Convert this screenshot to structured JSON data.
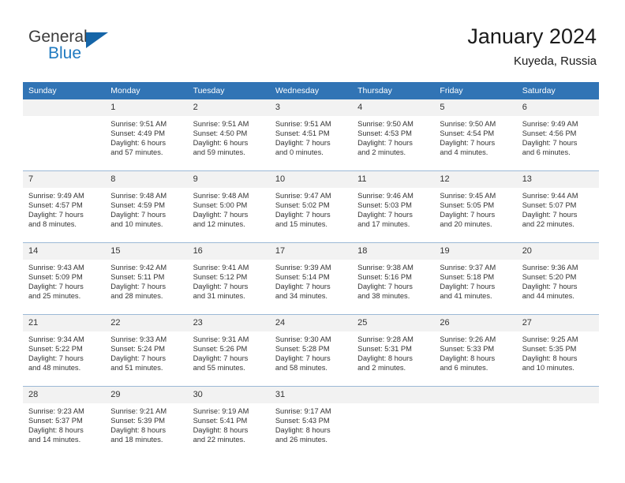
{
  "brand": {
    "name_part1": "General",
    "name_part2": "Blue",
    "triangle_icon": "blue-triangle-logo-mark"
  },
  "header": {
    "title": "January 2024",
    "subtitle": "Kuyeda, Russia"
  },
  "colors": {
    "header_band": "#3174b5",
    "daynum_band": "#f2f2f2",
    "row_divider": "#9cb9d6",
    "brand_blue": "#1f7ac0",
    "brand_dark": "#3c3c3c"
  },
  "weekdays": [
    "Sunday",
    "Monday",
    "Tuesday",
    "Wednesday",
    "Thursday",
    "Friday",
    "Saturday"
  ],
  "weeks": [
    [
      {
        "day": "",
        "sunrise": "",
        "sunset": "",
        "daylight1": "",
        "daylight2": ""
      },
      {
        "day": "1",
        "sunrise": "Sunrise: 9:51 AM",
        "sunset": "Sunset: 4:49 PM",
        "daylight1": "Daylight: 6 hours",
        "daylight2": "and 57 minutes."
      },
      {
        "day": "2",
        "sunrise": "Sunrise: 9:51 AM",
        "sunset": "Sunset: 4:50 PM",
        "daylight1": "Daylight: 6 hours",
        "daylight2": "and 59 minutes."
      },
      {
        "day": "3",
        "sunrise": "Sunrise: 9:51 AM",
        "sunset": "Sunset: 4:51 PM",
        "daylight1": "Daylight: 7 hours",
        "daylight2": "and 0 minutes."
      },
      {
        "day": "4",
        "sunrise": "Sunrise: 9:50 AM",
        "sunset": "Sunset: 4:53 PM",
        "daylight1": "Daylight: 7 hours",
        "daylight2": "and 2 minutes."
      },
      {
        "day": "5",
        "sunrise": "Sunrise: 9:50 AM",
        "sunset": "Sunset: 4:54 PM",
        "daylight1": "Daylight: 7 hours",
        "daylight2": "and 4 minutes."
      },
      {
        "day": "6",
        "sunrise": "Sunrise: 9:49 AM",
        "sunset": "Sunset: 4:56 PM",
        "daylight1": "Daylight: 7 hours",
        "daylight2": "and 6 minutes."
      }
    ],
    [
      {
        "day": "7",
        "sunrise": "Sunrise: 9:49 AM",
        "sunset": "Sunset: 4:57 PM",
        "daylight1": "Daylight: 7 hours",
        "daylight2": "and 8 minutes."
      },
      {
        "day": "8",
        "sunrise": "Sunrise: 9:48 AM",
        "sunset": "Sunset: 4:59 PM",
        "daylight1": "Daylight: 7 hours",
        "daylight2": "and 10 minutes."
      },
      {
        "day": "9",
        "sunrise": "Sunrise: 9:48 AM",
        "sunset": "Sunset: 5:00 PM",
        "daylight1": "Daylight: 7 hours",
        "daylight2": "and 12 minutes."
      },
      {
        "day": "10",
        "sunrise": "Sunrise: 9:47 AM",
        "sunset": "Sunset: 5:02 PM",
        "daylight1": "Daylight: 7 hours",
        "daylight2": "and 15 minutes."
      },
      {
        "day": "11",
        "sunrise": "Sunrise: 9:46 AM",
        "sunset": "Sunset: 5:03 PM",
        "daylight1": "Daylight: 7 hours",
        "daylight2": "and 17 minutes."
      },
      {
        "day": "12",
        "sunrise": "Sunrise: 9:45 AM",
        "sunset": "Sunset: 5:05 PM",
        "daylight1": "Daylight: 7 hours",
        "daylight2": "and 20 minutes."
      },
      {
        "day": "13",
        "sunrise": "Sunrise: 9:44 AM",
        "sunset": "Sunset: 5:07 PM",
        "daylight1": "Daylight: 7 hours",
        "daylight2": "and 22 minutes."
      }
    ],
    [
      {
        "day": "14",
        "sunrise": "Sunrise: 9:43 AM",
        "sunset": "Sunset: 5:09 PM",
        "daylight1": "Daylight: 7 hours",
        "daylight2": "and 25 minutes."
      },
      {
        "day": "15",
        "sunrise": "Sunrise: 9:42 AM",
        "sunset": "Sunset: 5:11 PM",
        "daylight1": "Daylight: 7 hours",
        "daylight2": "and 28 minutes."
      },
      {
        "day": "16",
        "sunrise": "Sunrise: 9:41 AM",
        "sunset": "Sunset: 5:12 PM",
        "daylight1": "Daylight: 7 hours",
        "daylight2": "and 31 minutes."
      },
      {
        "day": "17",
        "sunrise": "Sunrise: 9:39 AM",
        "sunset": "Sunset: 5:14 PM",
        "daylight1": "Daylight: 7 hours",
        "daylight2": "and 34 minutes."
      },
      {
        "day": "18",
        "sunrise": "Sunrise: 9:38 AM",
        "sunset": "Sunset: 5:16 PM",
        "daylight1": "Daylight: 7 hours",
        "daylight2": "and 38 minutes."
      },
      {
        "day": "19",
        "sunrise": "Sunrise: 9:37 AM",
        "sunset": "Sunset: 5:18 PM",
        "daylight1": "Daylight: 7 hours",
        "daylight2": "and 41 minutes."
      },
      {
        "day": "20",
        "sunrise": "Sunrise: 9:36 AM",
        "sunset": "Sunset: 5:20 PM",
        "daylight1": "Daylight: 7 hours",
        "daylight2": "and 44 minutes."
      }
    ],
    [
      {
        "day": "21",
        "sunrise": "Sunrise: 9:34 AM",
        "sunset": "Sunset: 5:22 PM",
        "daylight1": "Daylight: 7 hours",
        "daylight2": "and 48 minutes."
      },
      {
        "day": "22",
        "sunrise": "Sunrise: 9:33 AM",
        "sunset": "Sunset: 5:24 PM",
        "daylight1": "Daylight: 7 hours",
        "daylight2": "and 51 minutes."
      },
      {
        "day": "23",
        "sunrise": "Sunrise: 9:31 AM",
        "sunset": "Sunset: 5:26 PM",
        "daylight1": "Daylight: 7 hours",
        "daylight2": "and 55 minutes."
      },
      {
        "day": "24",
        "sunrise": "Sunrise: 9:30 AM",
        "sunset": "Sunset: 5:28 PM",
        "daylight1": "Daylight: 7 hours",
        "daylight2": "and 58 minutes."
      },
      {
        "day": "25",
        "sunrise": "Sunrise: 9:28 AM",
        "sunset": "Sunset: 5:31 PM",
        "daylight1": "Daylight: 8 hours",
        "daylight2": "and 2 minutes."
      },
      {
        "day": "26",
        "sunrise": "Sunrise: 9:26 AM",
        "sunset": "Sunset: 5:33 PM",
        "daylight1": "Daylight: 8 hours",
        "daylight2": "and 6 minutes."
      },
      {
        "day": "27",
        "sunrise": "Sunrise: 9:25 AM",
        "sunset": "Sunset: 5:35 PM",
        "daylight1": "Daylight: 8 hours",
        "daylight2": "and 10 minutes."
      }
    ],
    [
      {
        "day": "28",
        "sunrise": "Sunrise: 9:23 AM",
        "sunset": "Sunset: 5:37 PM",
        "daylight1": "Daylight: 8 hours",
        "daylight2": "and 14 minutes."
      },
      {
        "day": "29",
        "sunrise": "Sunrise: 9:21 AM",
        "sunset": "Sunset: 5:39 PM",
        "daylight1": "Daylight: 8 hours",
        "daylight2": "and 18 minutes."
      },
      {
        "day": "30",
        "sunrise": "Sunrise: 9:19 AM",
        "sunset": "Sunset: 5:41 PM",
        "daylight1": "Daylight: 8 hours",
        "daylight2": "and 22 minutes."
      },
      {
        "day": "31",
        "sunrise": "Sunrise: 9:17 AM",
        "sunset": "Sunset: 5:43 PM",
        "daylight1": "Daylight: 8 hours",
        "daylight2": "and 26 minutes."
      },
      {
        "day": "",
        "sunrise": "",
        "sunset": "",
        "daylight1": "",
        "daylight2": ""
      },
      {
        "day": "",
        "sunrise": "",
        "sunset": "",
        "daylight1": "",
        "daylight2": ""
      },
      {
        "day": "",
        "sunrise": "",
        "sunset": "",
        "daylight1": "",
        "daylight2": ""
      }
    ]
  ]
}
